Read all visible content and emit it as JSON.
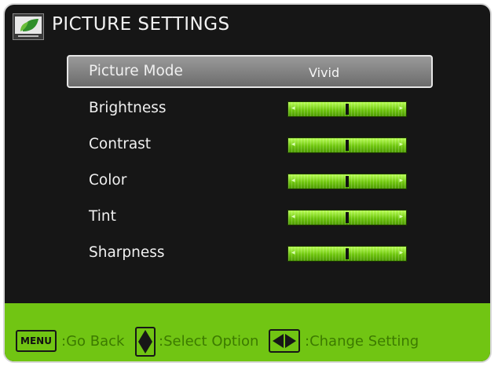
{
  "header": {
    "title": "PICTURE SETTINGS",
    "logo_icon": "leaf-logo-icon"
  },
  "menu": {
    "rows": [
      {
        "label": "Picture Mode",
        "value": "Vivid"
      },
      {
        "label": "Brightness",
        "level": 0.5
      },
      {
        "label": "Contrast",
        "level": 0.5
      },
      {
        "label": "Color",
        "level": 0.5
      },
      {
        "label": "Tint",
        "level": 0.5
      },
      {
        "label": "Sharpness",
        "level": 0.5
      }
    ],
    "selected_index": 0
  },
  "footer": {
    "menu_key_label": "MENU",
    "back_text": ":Go Back",
    "select_text": ":Select Option",
    "change_text": ":Change Setting"
  },
  "colors": {
    "accent_green": "#71c513",
    "background": "#161616",
    "selection": "#8a8a8a"
  }
}
